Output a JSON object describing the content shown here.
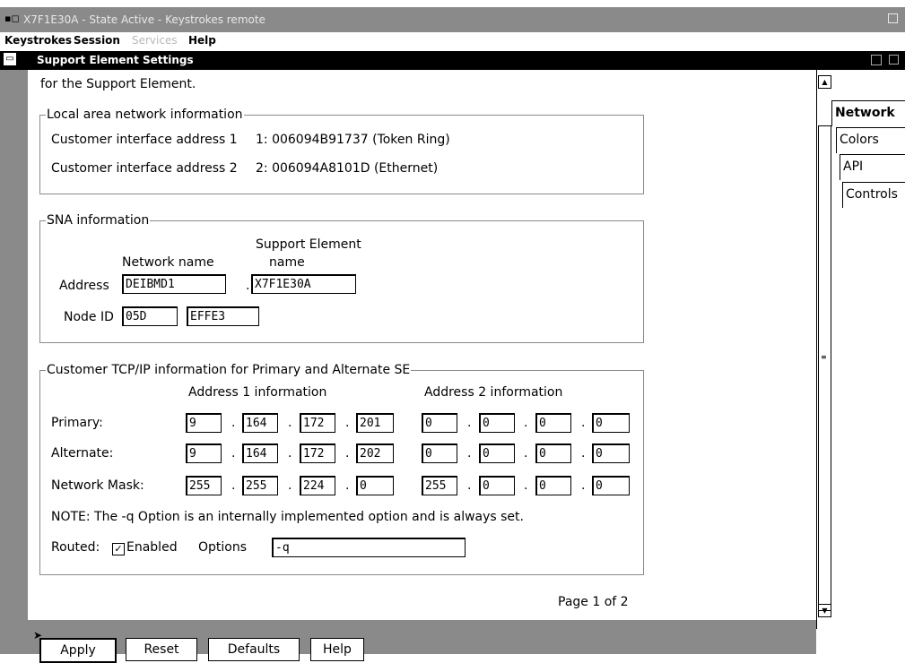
{
  "window": {
    "title": "X7F1E30A - State Active - Keystrokes remote"
  },
  "menubar": {
    "keystrokes": "Keystrokes",
    "session": "Session",
    "services": "Services",
    "help": "Help"
  },
  "dialog": {
    "title": "Support Element Settings",
    "intro_text": "for the Support Element.",
    "page_text": "Page 1 of 2"
  },
  "lan": {
    "legend": "Local area network information",
    "row1_label": "Customer interface address 1",
    "row1_value": "1: 006094B91737 (Token Ring)",
    "row2_label": "Customer interface address 2",
    "row2_value": "2: 006094A8101D (Ethernet)"
  },
  "sna": {
    "legend": "SNA information",
    "network_name_header": "Network name",
    "se_name_header_line1": "Support Element",
    "se_name_header_line2": "name",
    "address_label": "Address",
    "address_network": "DEIBMD1",
    "address_se": "X7F1E30A",
    "node_id_label": "Node ID",
    "node_id_1": "05D",
    "node_id_2": "EFFE3",
    "separator": "."
  },
  "tcpip": {
    "legend": "Customer TCP/IP information for Primary and Alternate SE",
    "addr1_header": "Address 1 information",
    "addr2_header": "Address 2 information",
    "dot": ".",
    "rows": [
      {
        "label": "Primary:",
        "a1": [
          "9",
          "164",
          "172",
          "201"
        ],
        "a2": [
          "0",
          "0",
          "0",
          "0"
        ]
      },
      {
        "label": "Alternate:",
        "a1": [
          "9",
          "164",
          "172",
          "202"
        ],
        "a2": [
          "0",
          "0",
          "0",
          "0"
        ]
      },
      {
        "label": "Network Mask:",
        "a1": [
          "255",
          "255",
          "224",
          "0"
        ],
        "a2": [
          "255",
          "0",
          "0",
          "0"
        ]
      }
    ],
    "note": "NOTE: The -q Option is an internally implemented option and is always set.",
    "routed_label": "Routed:",
    "enabled_label": "Enabled",
    "enabled_checked": true,
    "options_label": "Options",
    "options_value": "-q"
  },
  "tabs": [
    "Network",
    "Colors",
    "API",
    "Controls"
  ],
  "buttons": {
    "apply": "Apply",
    "reset": "Reset",
    "defaults": "Defaults",
    "help": "Help"
  },
  "colors": {
    "titlebar": "#8a8a8a",
    "dialog_titlebar": "#000000",
    "group_border": "#8a8a8a"
  }
}
